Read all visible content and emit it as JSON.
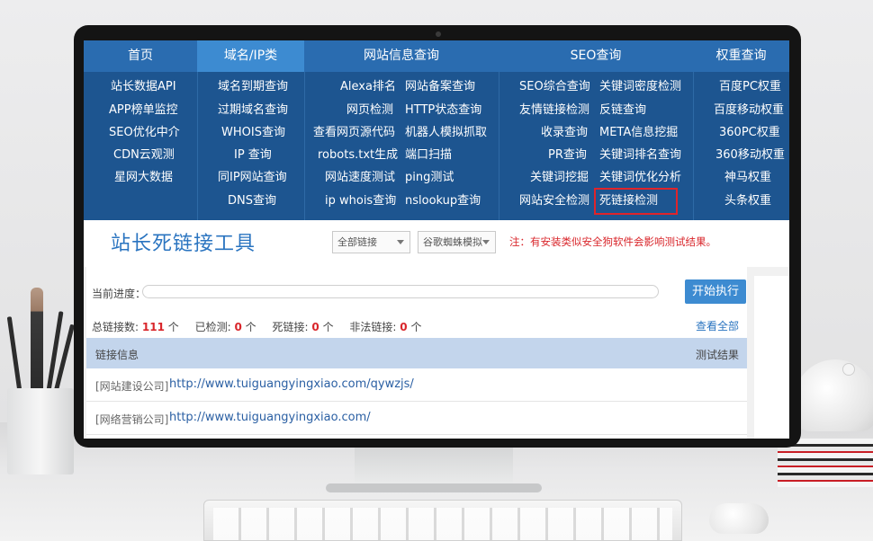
{
  "nav": {
    "tabs": [
      {
        "label": "首页",
        "active": false
      },
      {
        "label": "域名/IP类",
        "active": true
      },
      {
        "label": "网站信息查询",
        "active": false
      },
      {
        "label": "SEO查询",
        "active": false
      },
      {
        "label": "权重查询",
        "active": false
      }
    ],
    "columns": {
      "home": [
        "站长数据API",
        "APP榜单监控",
        "SEO优化中介",
        "CDN云观测",
        "星网大数据"
      ],
      "domain": [
        "域名到期查询",
        "过期域名查询",
        "WHOIS查询",
        "IP 查询",
        "同IP网站查询",
        "DNS查询"
      ],
      "siteinfo_a": [
        "Alexa排名",
        "网页检测",
        "查看网页源代码",
        "robots.txt生成",
        "网站速度测试",
        "ip whois查询"
      ],
      "siteinfo_b": [
        "网站备案查询",
        "HTTP状态查询",
        "机器人模拟抓取",
        "端口扫描",
        "ping测试",
        "nslookup查询"
      ],
      "seo_a": [
        "SEO综合查询",
        "友情链接检测",
        "收录查询",
        "PR查询",
        "关键词挖掘",
        "网站安全检测"
      ],
      "seo_b": [
        "关键词密度检测",
        "反链查询",
        "META信息挖掘",
        "关键词排名查询",
        "关键词优化分析",
        "死链接检测"
      ],
      "weight": [
        "百度PC权重",
        "百度移动权重",
        "360PC权重",
        "360移动权重",
        "神马权重",
        "头条权重"
      ]
    },
    "highlighted_item": "死链接检测"
  },
  "tool": {
    "title": "站长死链接工具",
    "select_scope": "全部链接",
    "select_spider": "谷歌蜘蛛模拟",
    "notice": "注：有安装类似安全狗软件会影响测试结果。"
  },
  "progress": {
    "label": "当前进度：",
    "value": 0,
    "start_button": "开始执行"
  },
  "stats": {
    "total_label": "总链接数:",
    "total": "111",
    "total_unit": "个",
    "checked_label": "已检测:",
    "checked": "0",
    "checked_unit": "个",
    "dead_label": "死链接:",
    "dead": "0",
    "dead_unit": "个",
    "illegal_label": "非法链接:",
    "illegal": "0",
    "illegal_unit": "个",
    "view_all": "查看全部"
  },
  "table": {
    "col_info": "链接信息",
    "col_result": "测试结果",
    "rows": [
      {
        "category": "[网站建设公司]",
        "url": "http://www.tuiguangyingxiao.com/qywzjs/"
      },
      {
        "category": "[网络营销公司]",
        "url": "http://www.tuiguangyingxiao.com/"
      }
    ]
  },
  "colors": {
    "nav_bg": "#1d5590",
    "tab_bar": "#2a6cb0",
    "active_tab": "#3d8bd1",
    "title": "#2a74c0",
    "alert_red": "#d9262b",
    "table_header": "#c3d5ec"
  }
}
